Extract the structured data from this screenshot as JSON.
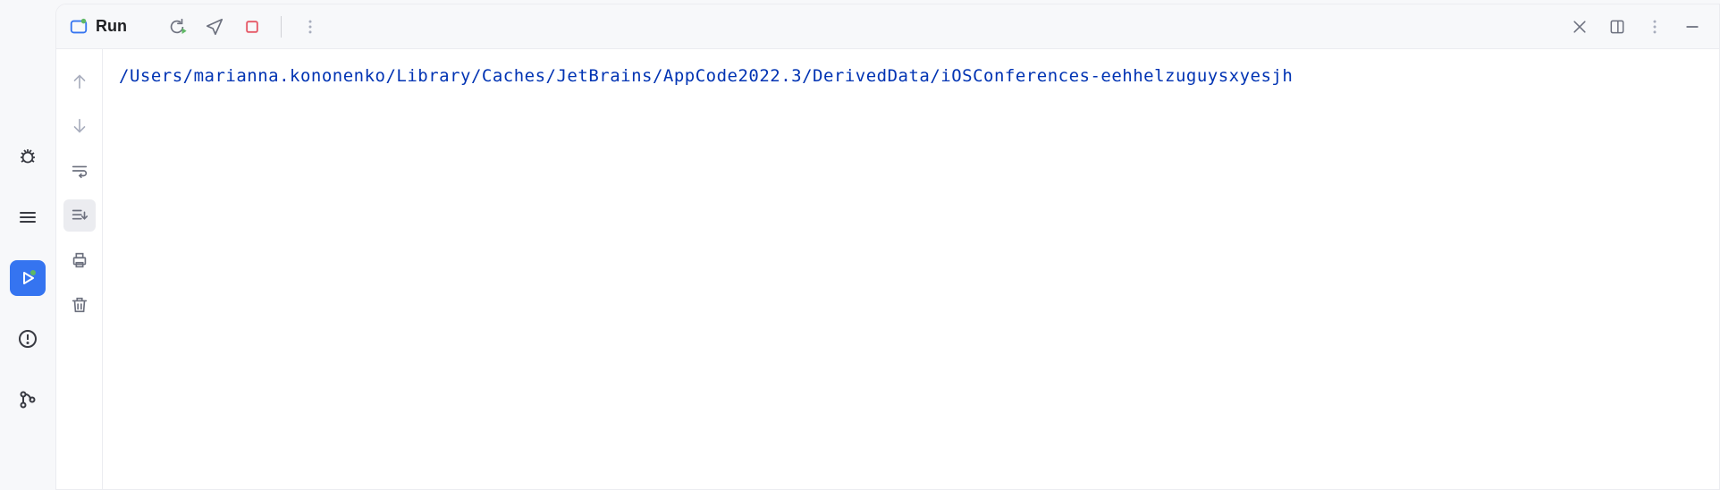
{
  "toolbar": {
    "title": "Run"
  },
  "console": {
    "output_line_1": "/Users/marianna.kononenko/Library/Caches/JetBrains/AppCode2022.3/DerivedData/iOSConferences-eehhelzuguysxyesjh"
  }
}
